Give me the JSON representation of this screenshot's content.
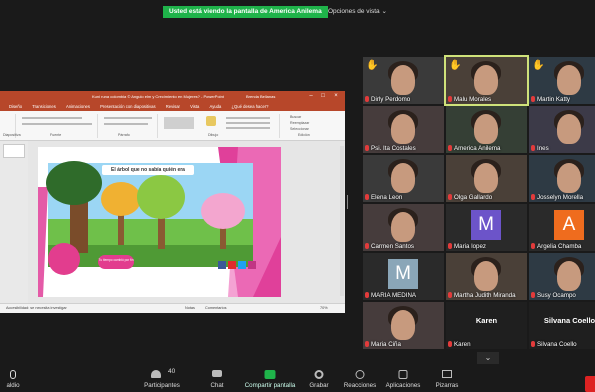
{
  "banner": {
    "sharing_text": "Usted está viendo la pantalla de America Anilema",
    "view_options": "Opciones de vista ⌄"
  },
  "ppt": {
    "title": "Kuni runa colombia © Angulo elm y Crecimiento en Mujeres? - PowerPoint",
    "user": "Brenda Bellanas",
    "menu": [
      "Diseño",
      "Transiciones",
      "Animaciones",
      "Presentación con diapositivas",
      "Revisar",
      "Vista",
      "Ayuda",
      "¿Qué desea hacer?"
    ],
    "ribbon_labels": [
      "Diapositiva",
      "Fuente",
      "Párrafo",
      "Dibujo",
      "Edición"
    ],
    "ribbon_actions": [
      "Buscar",
      "Reemplazar",
      "Seleccionar"
    ],
    "status_accessibility": "Accesibilidad: se necesita investigar",
    "status_items": [
      "Notas",
      "Comentarios"
    ],
    "zoom": "70%"
  },
  "slide": {
    "title": "El árbol que no sabía quién era",
    "circle_text": "Tu tiempo cambió por fin"
  },
  "participants": [
    {
      "name": "Dirly Perdomo",
      "hand": true,
      "kind": "video"
    },
    {
      "name": "Malu Morales",
      "hand": true,
      "kind": "video",
      "active": true
    },
    {
      "name": "Martin Katty",
      "hand": true,
      "kind": "video"
    },
    {
      "name": "Psi. Ita Costales",
      "hand": false,
      "kind": "video"
    },
    {
      "name": "America Anilema",
      "hand": false,
      "kind": "video"
    },
    {
      "name": "Ines",
      "hand": false,
      "kind": "video"
    },
    {
      "name": "Elena Leon",
      "hand": false,
      "kind": "video"
    },
    {
      "name": "Olga Gallardo",
      "hand": false,
      "kind": "video"
    },
    {
      "name": "Josselyn Morella",
      "hand": false,
      "kind": "video"
    },
    {
      "name": "Carmen Santos",
      "hand": false,
      "kind": "video"
    },
    {
      "name": "Maria lopez",
      "hand": false,
      "kind": "avatar",
      "letter": "M",
      "color": "#6c54c9"
    },
    {
      "name": "Argelia Chamba",
      "hand": false,
      "kind": "avatar",
      "letter": "A",
      "color": "#ef6c1e"
    },
    {
      "name": "MARIA MEDINA",
      "hand": false,
      "kind": "avatar",
      "letter": "M",
      "color": "#8aa6b8"
    },
    {
      "name": "Martha Judith Miranda",
      "hand": false,
      "kind": "video"
    },
    {
      "name": "Susy Ocampo",
      "hand": false,
      "kind": "video"
    },
    {
      "name": "Maria Ciña",
      "hand": false,
      "kind": "video"
    },
    {
      "name": "Karen",
      "hand": false,
      "kind": "text",
      "big": "Karen"
    },
    {
      "name": "Silvana Coello",
      "hand": false,
      "kind": "text",
      "big": "Silvana Coello"
    }
  ],
  "toolbar": {
    "audio": "aldio",
    "participants_label": "Participantes",
    "participants_count": "40",
    "chat": "Chat",
    "share": "Compartir pantalla",
    "record": "Grabar",
    "reactions": "Reacciones",
    "apps": "Aplicaciones",
    "whiteboard": "Pizarras"
  },
  "colors": {
    "share_green": "#1fb34a",
    "ppt_red": "#b7472a",
    "active_outline": "#cfe27a",
    "mic_red": "#e23b3b"
  }
}
